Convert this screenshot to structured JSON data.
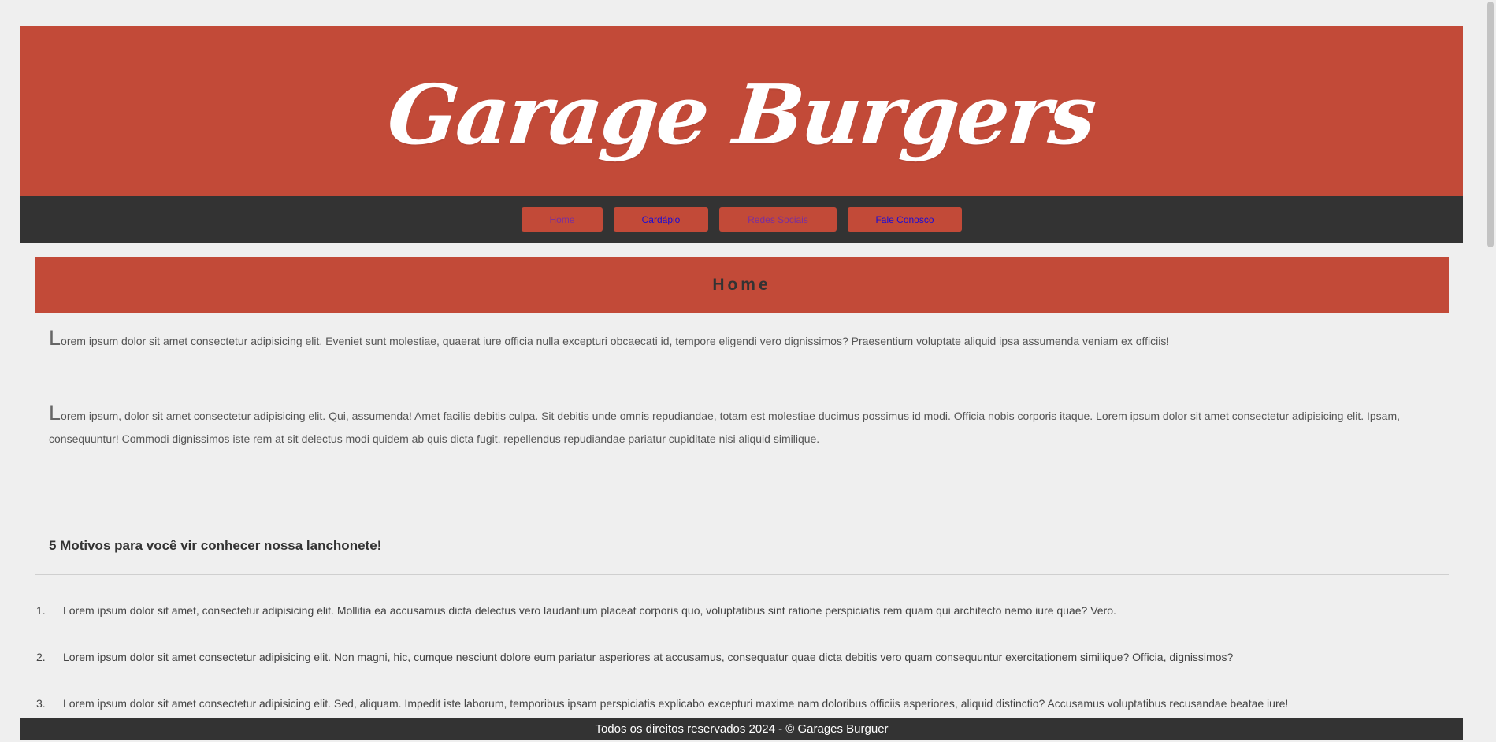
{
  "header": {
    "logo_text": "Garage Burgers"
  },
  "nav": {
    "items": [
      {
        "label": "Home"
      },
      {
        "label": "Cardápio"
      },
      {
        "label": "Redes Sociais"
      },
      {
        "label": "Fale Conosco"
      }
    ]
  },
  "main": {
    "section_title": "Home",
    "paragraphs": [
      {
        "dropcap": "L",
        "text": "orem ipsum dolor sit amet consectetur adipisicing elit. Eveniet sunt molestiae, quaerat iure officia nulla excepturi obcaecati id, tempore eligendi vero dignissimos? Praesentium voluptate aliquid ipsa assumenda veniam ex officiis!"
      },
      {
        "dropcap": "L",
        "text": "orem ipsum, dolor sit amet consectetur adipisicing elit. Qui, assumenda! Amet facilis debitis culpa. Sit debitis unde omnis repudiandae, totam est molestiae ducimus possimus id modi. Officia nobis corporis itaque. Lorem ipsum dolor sit amet consectetur adipisicing elit. Ipsam, consequuntur! Commodi dignissimos iste rem at sit delectus modi quidem ab quis dicta fugit, repellendus repudiandae pariatur cupiditate nisi aliquid similique."
      }
    ],
    "motivos_title": "5 Motivos para você vir conhecer nossa lanchonete!",
    "motivos": [
      {
        "num": "1.",
        "text": "Lorem ipsum dolor sit amet, consectetur adipisicing elit. Mollitia ea accusamus dicta delectus vero laudantium placeat corporis quo, voluptatibus sint ratione perspiciatis rem quam qui architecto nemo iure quae? Vero."
      },
      {
        "num": "2.",
        "text": "Lorem ipsum dolor sit amet consectetur adipisicing elit. Non magni, hic, cumque nesciunt dolore eum pariatur asperiores at accusamus, consequatur quae dicta debitis vero quam consequuntur exercitationem similique? Officia, dignissimos?"
      },
      {
        "num": "3.",
        "text": "Lorem ipsum dolor sit amet consectetur adipisicing elit. Sed, aliquam. Impedit iste laborum, temporibus ipsam perspiciatis explicabo excepturi maxime nam doloribus officiis asperiores, aliquid distinctio? Accusamus voluptatibus recusandae beatae iure!"
      }
    ]
  },
  "footer": {
    "text": "Todos os direitos reservados 2024 - © Garages Burguer"
  },
  "colors": {
    "brand_red": "#c24a38",
    "dark_bar": "#333333",
    "background": "#efefef",
    "link_visited": "#7a2f9e",
    "link_unvisited": "#1a0dd8"
  }
}
